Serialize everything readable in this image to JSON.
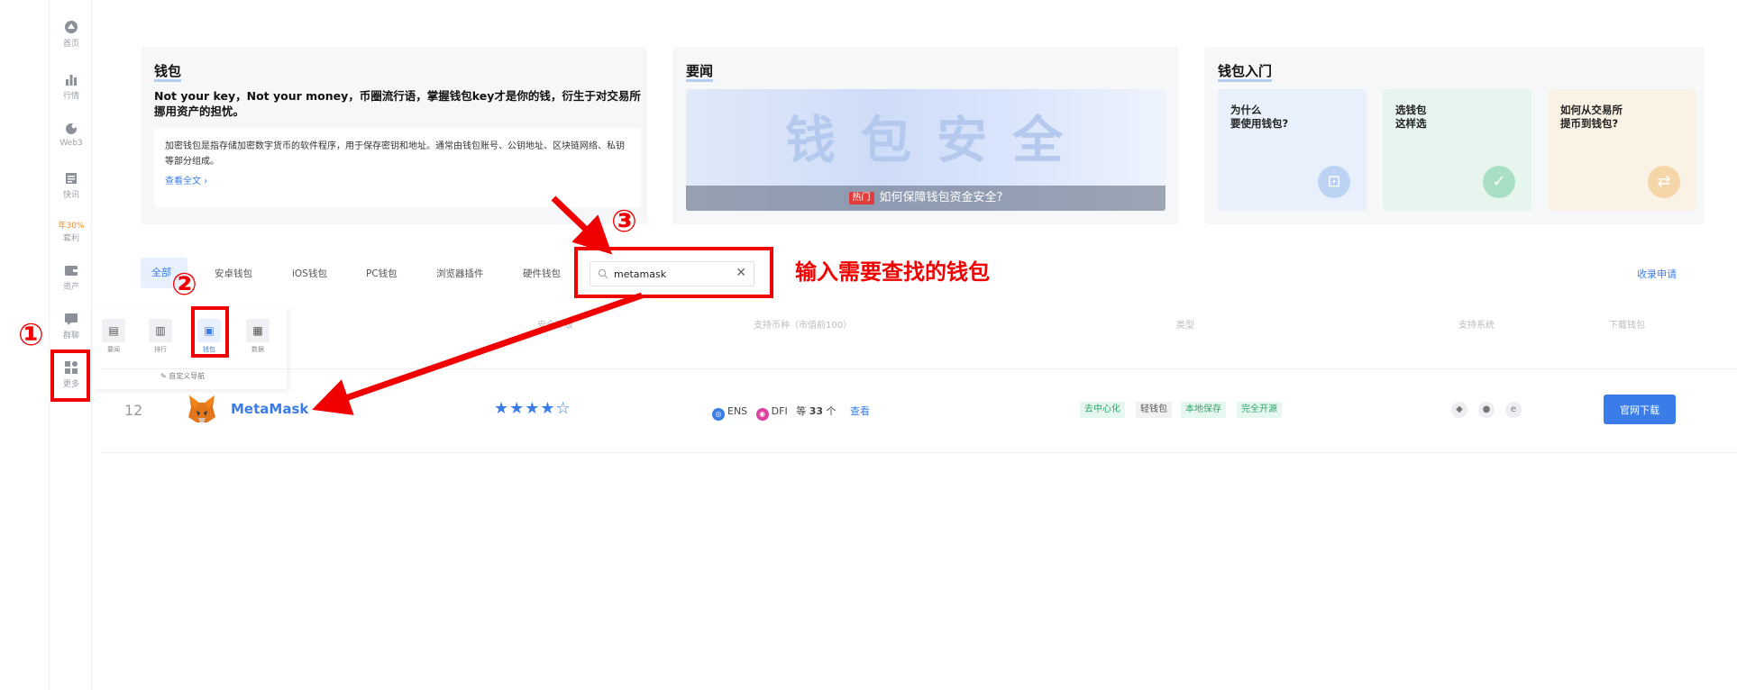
{
  "rail": {
    "items": [
      {
        "label": "首页",
        "icon": "home-icon"
      },
      {
        "label": "行情",
        "icon": "chart-icon"
      },
      {
        "label": "Web3",
        "icon": "web3-icon"
      },
      {
        "label": "快讯",
        "icon": "news-icon"
      },
      {
        "label": "年30%",
        "label2": "套利",
        "icon": "promo"
      },
      {
        "label": "资产",
        "icon": "asset-icon"
      },
      {
        "label": "群聊",
        "icon": "chat-icon"
      },
      {
        "label": "更多",
        "icon": "more-icon"
      }
    ]
  },
  "cards": {
    "wallet": {
      "title": "钱包",
      "headline": "Not your key，Not your money，币圈流行语，掌握钱包key才是你的钱，衍生于对交易所挪用资产的担忧。",
      "desc": "加密钱包是指存储加密数字货币的软件程序，用于保存密钥和地址。通常由钱包账号、公钥地址、区块链网络、私钥等部分组成。",
      "more": "查看全文 ›"
    },
    "news": {
      "title": "要闻",
      "banner_big": "钱包安全",
      "hot_tag": "热门",
      "banner_caption": "如何保障钱包资金安全?"
    },
    "guide": {
      "title": "钱包入门",
      "items": [
        {
          "text": "为什么\n要使用钱包?",
          "bg": "#e8f0fb",
          "badge": "#bcd3f3"
        },
        {
          "text": "选钱包\n这样选",
          "bg": "#e7f5ef",
          "badge": "#a9e0c5"
        },
        {
          "text": "如何从交易所\n提币到钱包?",
          "bg": "#fbf2e6",
          "badge": "#f4d6a8"
        }
      ]
    }
  },
  "tabs": [
    "全部",
    "安卓钱包",
    "iOS钱包",
    "PC钱包",
    "浏览器插件",
    "硬件钱包"
  ],
  "search": {
    "value": "metamask"
  },
  "apply_link": "收录申请",
  "table_headers": [
    "安全评级",
    "支持币种（市值前100）",
    "类型",
    "支持系统",
    "下载钱包"
  ],
  "more_menu": {
    "items": [
      {
        "label": "要闻",
        "glyph": "▤"
      },
      {
        "label": "排行",
        "glyph": "▥"
      },
      {
        "label": "钱包",
        "glyph": "▣"
      },
      {
        "label": "数据",
        "glyph": "▦"
      }
    ],
    "custom": "✎ 自定义导航"
  },
  "row": {
    "rank": "12",
    "name": "MetaMask",
    "stars": "★★★★☆",
    "coins": [
      {
        "name": "ENS",
        "color": "#3b7de8"
      },
      {
        "name": "DFI",
        "color": "#e040a0"
      }
    ],
    "coins_more_prefix": "等",
    "coins_count": "33",
    "coins_unit": "个",
    "coins_link": "查看",
    "tags": [
      {
        "text": "去中心化",
        "bg": "#e6f7ef",
        "fg": "#2fa66a"
      },
      {
        "text": "轻钱包",
        "bg": "#f0f1f3",
        "fg": "#555555"
      },
      {
        "text": "本地保存",
        "bg": "#e6f7ef",
        "fg": "#2fa66a"
      },
      {
        "text": "完全开源",
        "bg": "#e6f7ef",
        "fg": "#2fa66a"
      }
    ],
    "os": [
      "android-icon",
      "apple-icon",
      "browser-icon"
    ],
    "download": "官网下载"
  },
  "annotations": {
    "num1": "①",
    "num2": "②",
    "num3": "③",
    "note": "输入需要查找的钱包",
    "color": "#f00000"
  }
}
